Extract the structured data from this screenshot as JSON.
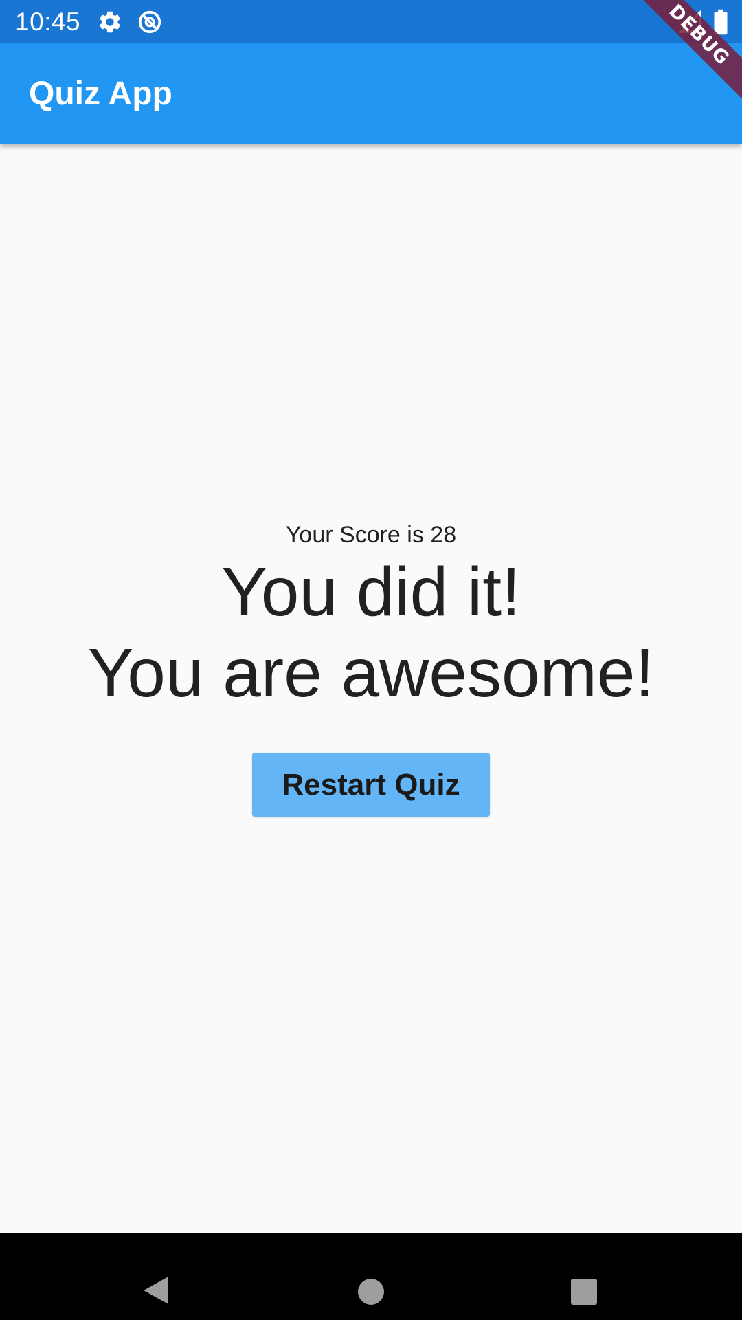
{
  "status_bar": {
    "time": "10:45",
    "icons_left": [
      "gear-icon",
      "no-tracking-icon"
    ],
    "icons_right": [
      "signal-icon",
      "battery-icon"
    ],
    "background_color": "#1976d2"
  },
  "debug_banner": {
    "label": "DEBUG"
  },
  "app_bar": {
    "title": "Quiz App",
    "background_color": "#2196f3"
  },
  "result": {
    "score_text": "Your Score is 28",
    "line_1": "You did it!",
    "line_2": "You are awesome!"
  },
  "restart_button": {
    "label": "Restart Quiz",
    "background_color": "#64b5f6"
  },
  "nav_bar": {
    "buttons": [
      "back-icon",
      "home-icon",
      "recents-icon"
    ]
  }
}
